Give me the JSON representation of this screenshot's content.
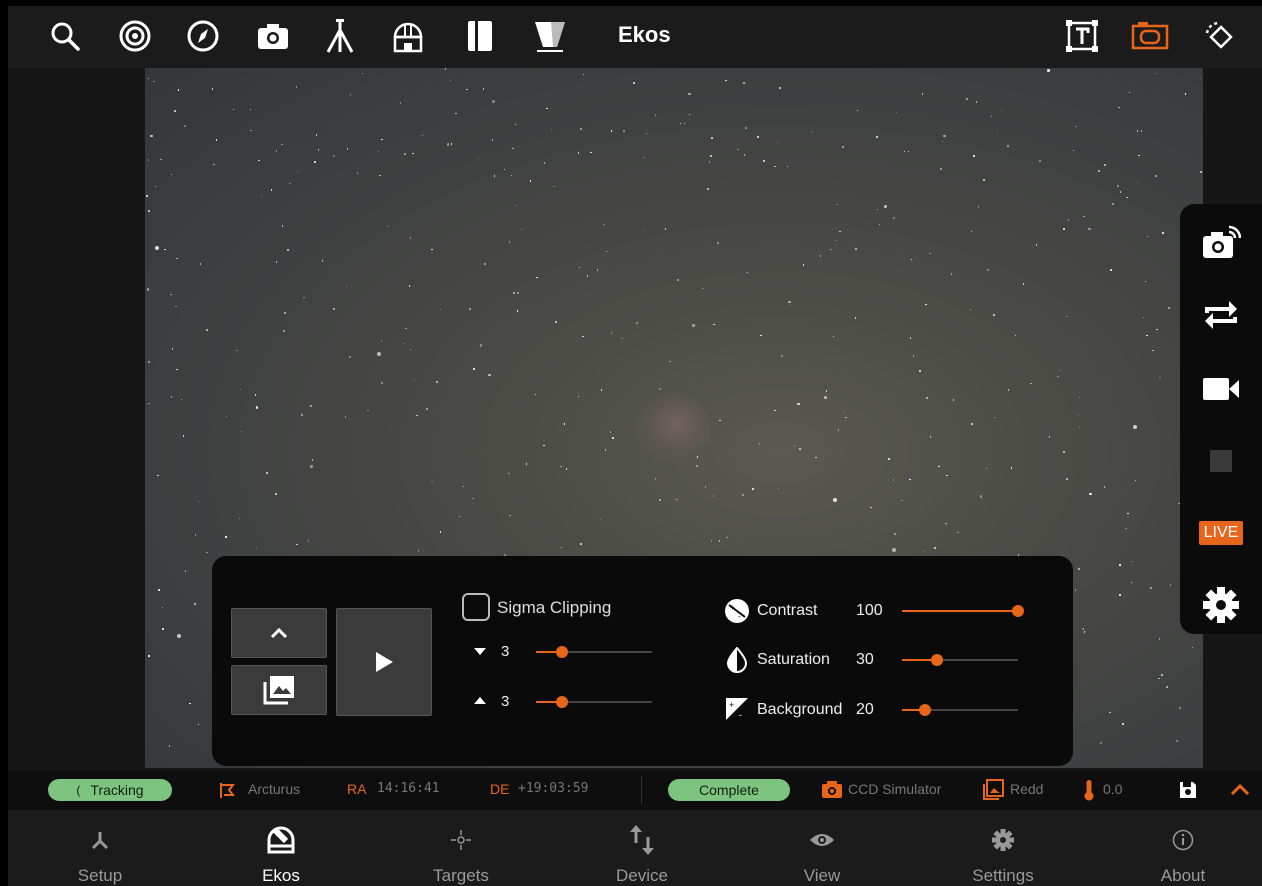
{
  "topbar": {
    "title": "Ekos",
    "icons": [
      "search-icon",
      "target-icon",
      "compass-icon",
      "camera-icon",
      "telescope-icon",
      "observatory-icon",
      "notebook-icon",
      "filter-icon",
      "text-frame-icon",
      "fits-view-icon",
      "rotate-icon"
    ],
    "active_color": "#e8651c"
  },
  "side_panel": {
    "buttons": [
      "capture-icon",
      "loop-icon",
      "video-icon",
      "stop-icon",
      "live-button",
      "settings-icon"
    ],
    "live_label": "LIVE"
  },
  "controls": {
    "sigma_label": "Sigma Clipping",
    "sigma_low_value": "3",
    "sigma_high_value": "3",
    "sigma_low_level": 0.22,
    "sigma_high_level": 0.22,
    "contrast_label": "Contrast",
    "contrast_value": "100",
    "contrast_level": 1.0,
    "saturation_label": "Saturation",
    "saturation_value": "30",
    "saturation_level": 0.3,
    "background_label": "Background",
    "background_value": "20",
    "background_level": 0.2
  },
  "status": {
    "tracking": "Tracking",
    "target": "Arcturus",
    "ra_label": "RA",
    "ra_value": "14:16:41",
    "de_label": "DE",
    "de_value": "+19:03:59",
    "capture_state": "Complete",
    "camera": "CCD Simulator",
    "filter": "Redd",
    "temperature": "0.0"
  },
  "nav": {
    "items": [
      {
        "label": "Setup",
        "icon": "setup-icon"
      },
      {
        "label": "Ekos",
        "icon": "ekos-icon"
      },
      {
        "label": "Targets",
        "icon": "targets-icon"
      },
      {
        "label": "Device",
        "icon": "device-icon"
      },
      {
        "label": "View",
        "icon": "view-icon"
      },
      {
        "label": "Settings",
        "icon": "settings-icon"
      },
      {
        "label": "About",
        "icon": "about-icon"
      }
    ],
    "active": "Ekos"
  }
}
